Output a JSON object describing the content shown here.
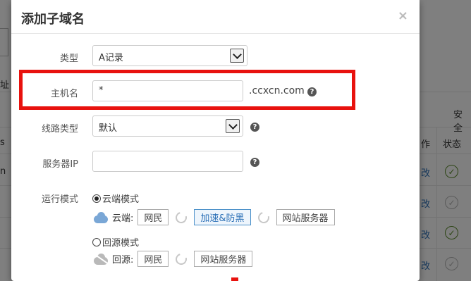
{
  "background": {
    "left_fragments": [
      "址",
      "s",
      "n"
    ],
    "column_headers": {
      "security": "安全",
      "action": "作",
      "status": "状态"
    },
    "edit_links": [
      "改",
      "改",
      "改",
      "改"
    ],
    "status_icons": [
      "check-active",
      "check-inactive",
      "check-active",
      "check-inactive"
    ]
  },
  "modal": {
    "title": "添加子域名",
    "close_glyph": "×",
    "type": {
      "label": "类型",
      "value": "A记录"
    },
    "hostname": {
      "label": "主机名",
      "value": "*",
      "suffix": ".ccxcn.com",
      "help": "?"
    },
    "line_type": {
      "label": "线路类型",
      "value": "默认",
      "help": "?"
    },
    "server_ip": {
      "label": "服务器IP",
      "value": "",
      "help": "?"
    },
    "run_mode": {
      "label": "运行模式",
      "cloud_option": "云端模式",
      "cloud_row": {
        "label": "云端:",
        "steps": [
          "网民",
          "加速&防黑",
          "网站服务器"
        ]
      },
      "origin_option": "回源模式",
      "origin_row": {
        "label": "回源:",
        "steps": [
          "网民",
          "网站服务器"
        ]
      }
    }
  },
  "colors": {
    "highlight": "#e8120e",
    "link": "#2a6fb6",
    "ok": "#5a8a2a"
  }
}
